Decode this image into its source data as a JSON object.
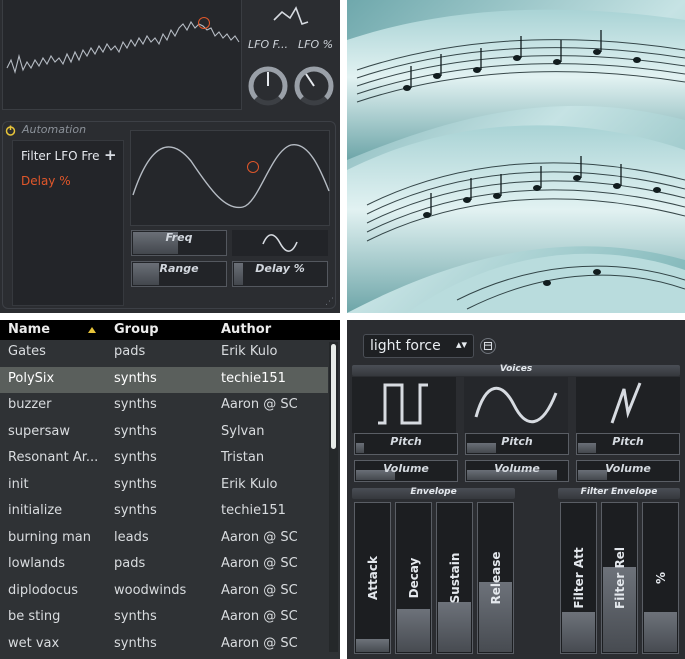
{
  "lfo_panel": {
    "mini_labels": [
      "LFO F...",
      "LFO %"
    ],
    "automation": {
      "title": "Automation",
      "items": [
        {
          "label": "Filter LFO Fre",
          "color": "#e6e9ee"
        },
        {
          "label": "Delay %",
          "color": "#e0572a"
        }
      ],
      "controls": {
        "freq": {
          "label": "Freq",
          "level": 0.5
        },
        "range": {
          "label": "Range",
          "level": 0.3
        },
        "delay": {
          "label": "Delay %",
          "level": 0.12
        }
      }
    }
  },
  "preset_browser": {
    "columns": [
      "Name",
      "Group",
      "Author"
    ],
    "selected_index": 1,
    "rows": [
      [
        "Gates",
        "pads",
        "Erik Kulo"
      ],
      [
        "PolySix",
        "synths",
        "techie151"
      ],
      [
        "buzzer",
        "synths",
        "Aaron @ SC"
      ],
      [
        "supersaw",
        "synths",
        "Sylvan"
      ],
      [
        "Resonant Ar...",
        "synths",
        "Tristan"
      ],
      [
        "init",
        "synths",
        "Erik Kulo"
      ],
      [
        "initialize",
        "synths",
        "techie151"
      ],
      [
        "burning man",
        "leads",
        "Aaron @ SC"
      ],
      [
        "lowlands",
        "pads",
        "Aaron @ SC"
      ],
      [
        "diplodocus",
        "woodwinds",
        "Aaron @ SC"
      ],
      [
        "be sting",
        "synths",
        "Aaron @ SC"
      ],
      [
        "wet vax",
        "synths",
        "Aaron @ SC"
      ]
    ]
  },
  "synth": {
    "preset": "light force",
    "sections": {
      "voices": "Voices",
      "envelope": "Envelope",
      "filter_envelope": "Filter Envelope"
    },
    "voices": [
      {
        "wave_icon": "square-wave-icon",
        "pitch": "Pitch",
        "volume": "Volume",
        "pitch_level": 0.1,
        "volume_level": 0.4
      },
      {
        "wave_icon": "sine-wave-icon",
        "pitch": "Pitch",
        "volume": "Volume",
        "pitch_level": 0.3,
        "volume_level": 0.9
      },
      {
        "wave_icon": "saw-wave-icon",
        "pitch": "Pitch",
        "volume": "Volume",
        "pitch_level": 0.2,
        "volume_level": 0.3
      }
    ],
    "envelope": [
      {
        "label": "Attack",
        "level": 0.1
      },
      {
        "label": "Decay",
        "level": 0.3
      },
      {
        "label": "Sustain",
        "level": 0.35
      },
      {
        "label": "Release",
        "level": 0.48
      }
    ],
    "filter_envelope": [
      {
        "label": "Filter Att",
        "level": 0.28
      },
      {
        "label": "Filter Rel",
        "level": 0.58
      },
      {
        "label": "%",
        "level": 0.28
      }
    ]
  }
}
